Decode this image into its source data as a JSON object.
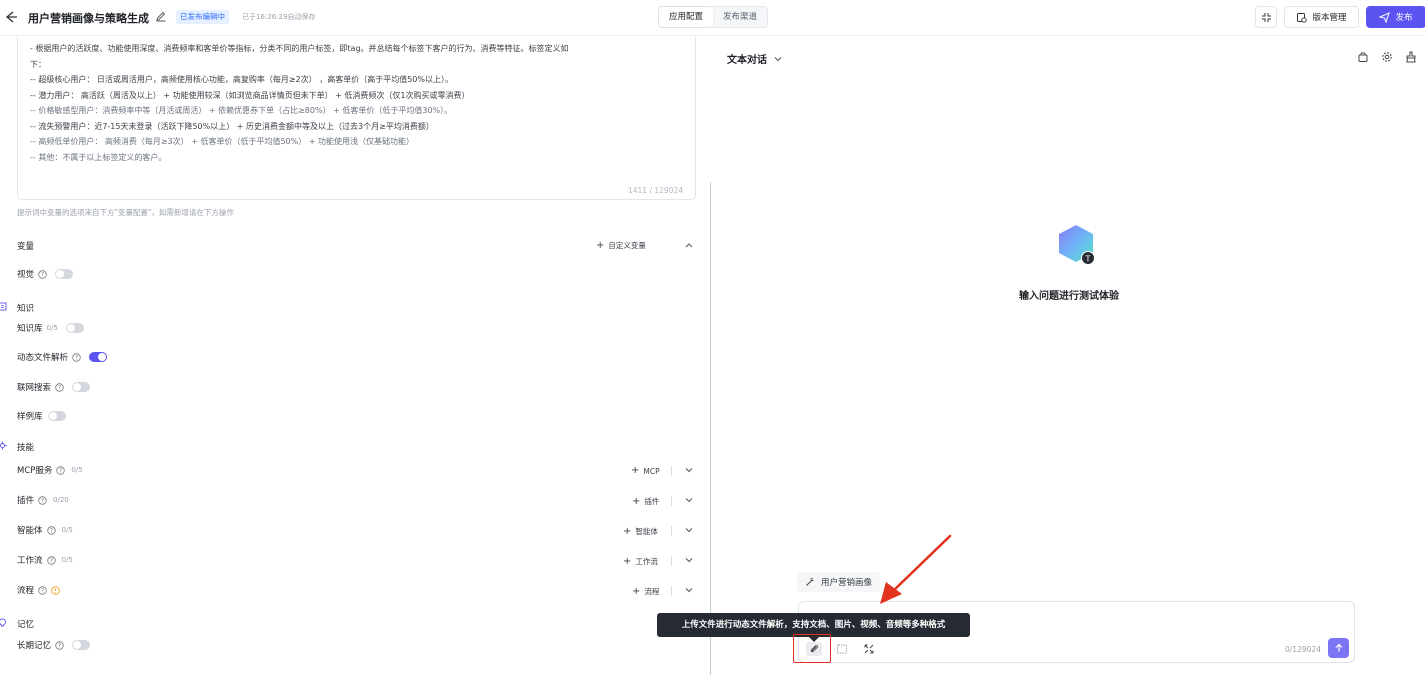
{
  "header": {
    "title": "用户营销画像与策略生成",
    "status_badge": "已发布编辑中",
    "autosave_text": "已于16:26:29自动保存",
    "mode_tabs": [
      "应用配置",
      "发布渠道"
    ],
    "active_tab": "应用配置",
    "version_label": "版本管理",
    "publish_label": "发布",
    "accent_color": "#5b54f0"
  },
  "prompt": {
    "lines": [
      "- 根据用户的活跃度、功能使用深度、消费频率和客单价等指标，分类不同的用户标签，即tag。并总结每个标签下客户的行为、消费等特征。标签定义如",
      "下：",
      " -- 超级核心用户： 日活或周活用户，高频使用核心功能，高复购率（每月≥2次）  ，高客单价（高于平均值50%以上）。",
      "-- 潜力用户： 高活跃（周活及以上）  + 功能使用较深（如浏览商品详情页但未下单）  + 低消费频次（仅1次购买或零消费）",
      "-- 价格敏感型用户：消费频率中等（月活或周活）  + 依赖优惠券下单（占比≥80%）  + 低客单价（低于平均值30%）。",
      "-- 流失预警用户：近7-15天未登录（活跃下降50%以上）  + 历史消费金额中等及以上（过去3个月≥平均消费额）",
      "-- 高频低单价用户： 高频消费（每月≥3次）  + 低客单价（低于平均值50%）  + 功能使用浅（仅基础功能）",
      "-- 其他：不属于以上标签定义的客户。"
    ],
    "char_count": "1411 / 129024",
    "hint": "提示词中变量的选项来自下方\"变量配置\"，如需新增请在下方操作"
  },
  "variables": {
    "title": "变量",
    "add_label": "自定义变量"
  },
  "vision": {
    "label": "视觉",
    "enabled": false
  },
  "knowledge": {
    "title": "知识",
    "items": [
      {
        "label": "知识库",
        "count": "0/5",
        "enabled": false
      },
      {
        "label": "动态文件解析",
        "count": "",
        "enabled": true
      },
      {
        "label": "联网搜索",
        "count": "",
        "enabled": false
      },
      {
        "label": "样例库",
        "count": "",
        "enabled": false
      }
    ]
  },
  "skills": {
    "title": "技能",
    "items": [
      {
        "label": "MCP服务",
        "count": "0/5",
        "add": "MCP"
      },
      {
        "label": "插件",
        "count": "0/20",
        "add": "插件"
      },
      {
        "label": "智能体",
        "count": "0/5",
        "add": "智能体"
      },
      {
        "label": "工作流",
        "count": "0/5",
        "add": "工作流"
      },
      {
        "label": "流程",
        "count": "",
        "add": "流程"
      }
    ]
  },
  "memory": {
    "title": "记忆",
    "long_term_label": "长期记忆",
    "enabled": false
  },
  "chat": {
    "mode_label": "文本对话",
    "empty_text": "输入问题进行测试体验",
    "logo_badge": "T",
    "suggestion": "用户营销画像",
    "tooltip": "上传文件进行动态文件解析，支持文档、图片、视频、音频等多种格式",
    "input_count": "0/129024"
  },
  "colors": {
    "accent": "#5b54f0",
    "highlight_red": "#e2331f",
    "badge_bg": "#e6f0ff",
    "badge_text": "#2f6bff"
  }
}
